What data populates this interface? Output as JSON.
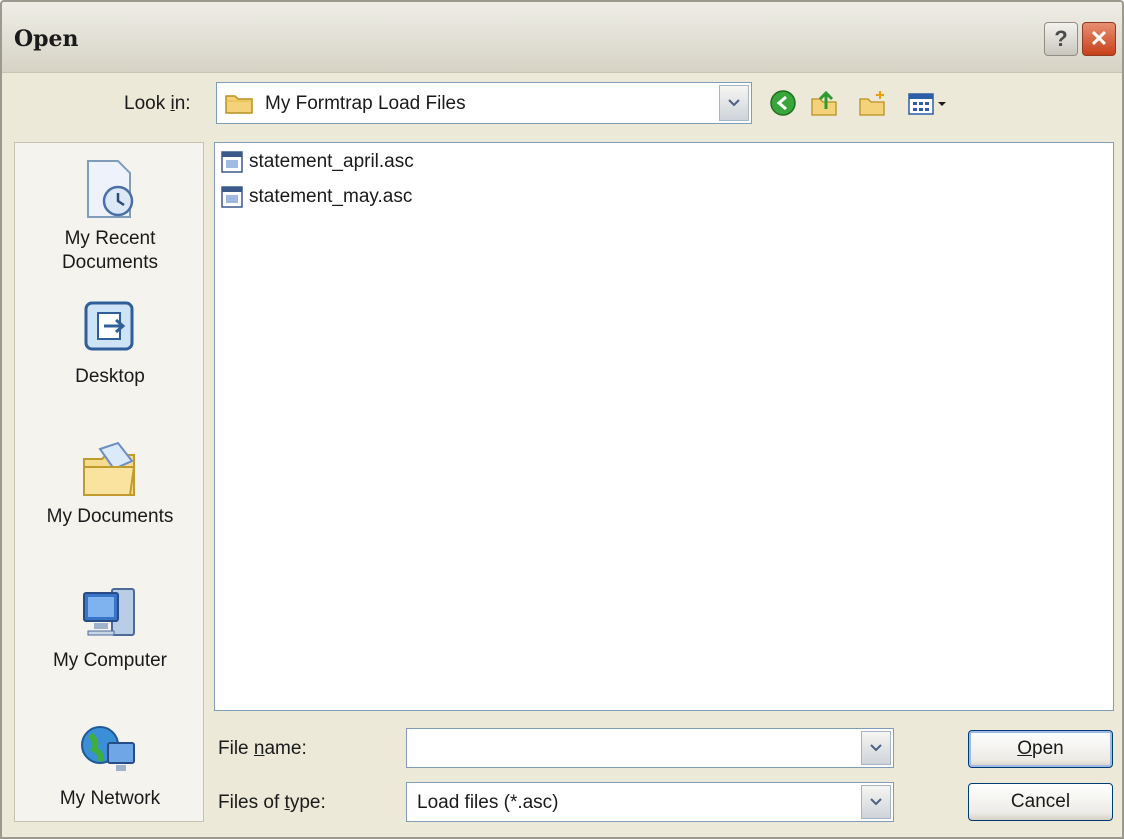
{
  "window": {
    "title": "Open"
  },
  "title_buttons": {
    "help_glyph": "?",
    "close_glyph": "✕"
  },
  "look_in": {
    "label": "Look in:",
    "label_accel": "i",
    "value": "My Formtrap Load Files",
    "icon": "folder-icon"
  },
  "toolbar": [
    "back-icon",
    "up-folder-icon",
    "new-folder-icon",
    "views-menu-icon"
  ],
  "places": [
    {
      "label_line1": "My Recent",
      "label_line2": "Documents",
      "icon": "recent-documents-icon"
    },
    {
      "label_line1": "Desktop",
      "label_line2": "",
      "icon": "desktop-icon"
    },
    {
      "label_line1": "My Documents",
      "label_line2": "",
      "icon": "my-documents-icon"
    },
    {
      "label_line1": "My Computer",
      "label_line2": "",
      "icon": "my-computer-icon"
    },
    {
      "label_line1": "My Network",
      "label_line2": "",
      "icon": "my-network-icon"
    }
  ],
  "files": [
    {
      "name": "statement_april.asc",
      "icon": "asc-file-icon"
    },
    {
      "name": "statement_may.asc",
      "icon": "asc-file-icon"
    }
  ],
  "file_name": {
    "label_pre": "File ",
    "label_accel": "n",
    "label_post": "ame:",
    "value": ""
  },
  "file_type": {
    "label_pre": "Files of ",
    "label_accel": "t",
    "label_post": "ype:",
    "value": "Load files (*.asc)"
  },
  "buttons": {
    "open_accel": "O",
    "open_rest": "pen",
    "cancel": "Cancel"
  },
  "colors": {
    "dialog_bg": "#ece9d8",
    "border_blue": "#7f9db9",
    "close_red": "#c7411a"
  }
}
